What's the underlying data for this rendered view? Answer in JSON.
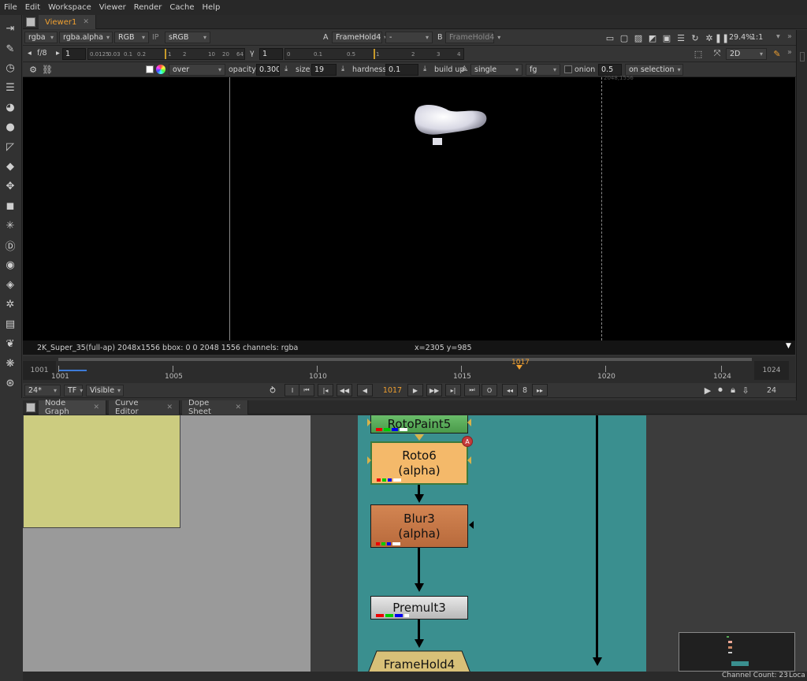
{
  "menu": [
    "File",
    "Edit",
    "Workspace",
    "Viewer",
    "Render",
    "Cache",
    "Help"
  ],
  "viewer_tab": {
    "label": "Viewer1",
    "close": "✕"
  },
  "viewer_controls": {
    "channels": "rgba",
    "alpha_channel": "rgba.alpha",
    "display_channel": "RGB",
    "ip_label": "IP",
    "lut": "sRGB",
    "input_a_label": "A",
    "input_a": "FrameHold4",
    "compare_mode": "-",
    "input_b_label": "B",
    "input_b": "FrameHold4",
    "zoom": "29.4%",
    "ratio": "1:1",
    "fstop_label": "f/8",
    "gain_value": "1",
    "gamma_label": "γ",
    "gamma_value": "1",
    "gain_scale": [
      "0.0125",
      "0.03",
      "0.1",
      "0.2",
      "1",
      "2",
      "10",
      "20",
      "64"
    ],
    "gamma_scale": [
      "0",
      "0.1",
      "0.5",
      "1",
      "2",
      "3",
      "4"
    ],
    "view_mode": "2D"
  },
  "paint_controls": {
    "blend_mode": "over",
    "opacity_label": "opacity",
    "opacity_value": "0.3000",
    "size_label": "size",
    "size_value": "19",
    "hardness_label": "hardness",
    "hardness_value": "0.1",
    "buildup_label": "build up",
    "stroke_mode": "single",
    "fg": "fg",
    "onion_label": "onion",
    "onion_value": "0.5",
    "lifetime": "on selection"
  },
  "viewer_status": {
    "format": "2K_Super_35(full-ap) 2048x1556  bbox: 0 0 2048 1556 channels: rgba",
    "coords": "x=2305 y=985",
    "corner_label": "2048,1556"
  },
  "timeline": {
    "start": "1001",
    "end": "1024",
    "current": "1017",
    "marks": [
      "1001",
      "1005",
      "1010",
      "1015",
      "1020",
      "1024"
    ],
    "fps": "24*",
    "tf": "TF",
    "visible": "Visible",
    "step": "8",
    "increment": "24"
  },
  "nodegraph_tabs": [
    {
      "label": "Node Graph",
      "close": "✕"
    },
    {
      "label": "Curve Editor",
      "close": "✕"
    },
    {
      "label": "Dope Sheet",
      "close": "✕"
    }
  ],
  "nodes": [
    {
      "name": "RotoPaint5"
    },
    {
      "name": "Roto6",
      "sub": "(alpha)",
      "badge": "A"
    },
    {
      "name": "Blur3",
      "sub": "(alpha)"
    },
    {
      "name": "Premult3"
    },
    {
      "name": "FrameHold4"
    }
  ],
  "footer": {
    "channel_count": "Channel Count: 23",
    "locale": "Loca"
  },
  "colors": {
    "accent": "#f0a030",
    "backdrop_teal": "#3a8f8f",
    "backdrop_yellow": "#cccc80",
    "roto_node": "#f4b96a",
    "blur_node": "#c8784a",
    "rotopaint_node": "#5fb35f"
  }
}
